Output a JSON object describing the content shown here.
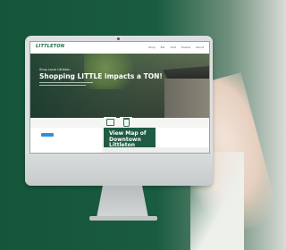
{
  "colors": {
    "background_green": "#1a5c40",
    "brand_green": "#1f5c43",
    "accent_blue": "#2d8fd8",
    "monitor_silver": "#dcdfe0"
  },
  "website": {
    "logo": "LITTLETON",
    "nav": [
      "Shop",
      "Eat",
      "Visit",
      "Events",
      "About"
    ],
    "hero": {
      "kicker": "Shop Local Littleton",
      "title": "Shopping LITTLE impacts a TON!"
    },
    "tiles": {
      "icon_left": "gift-icon",
      "icon_right": "cup-icon"
    },
    "map_card": {
      "title": "View Map of Downtown Littleton"
    }
  }
}
